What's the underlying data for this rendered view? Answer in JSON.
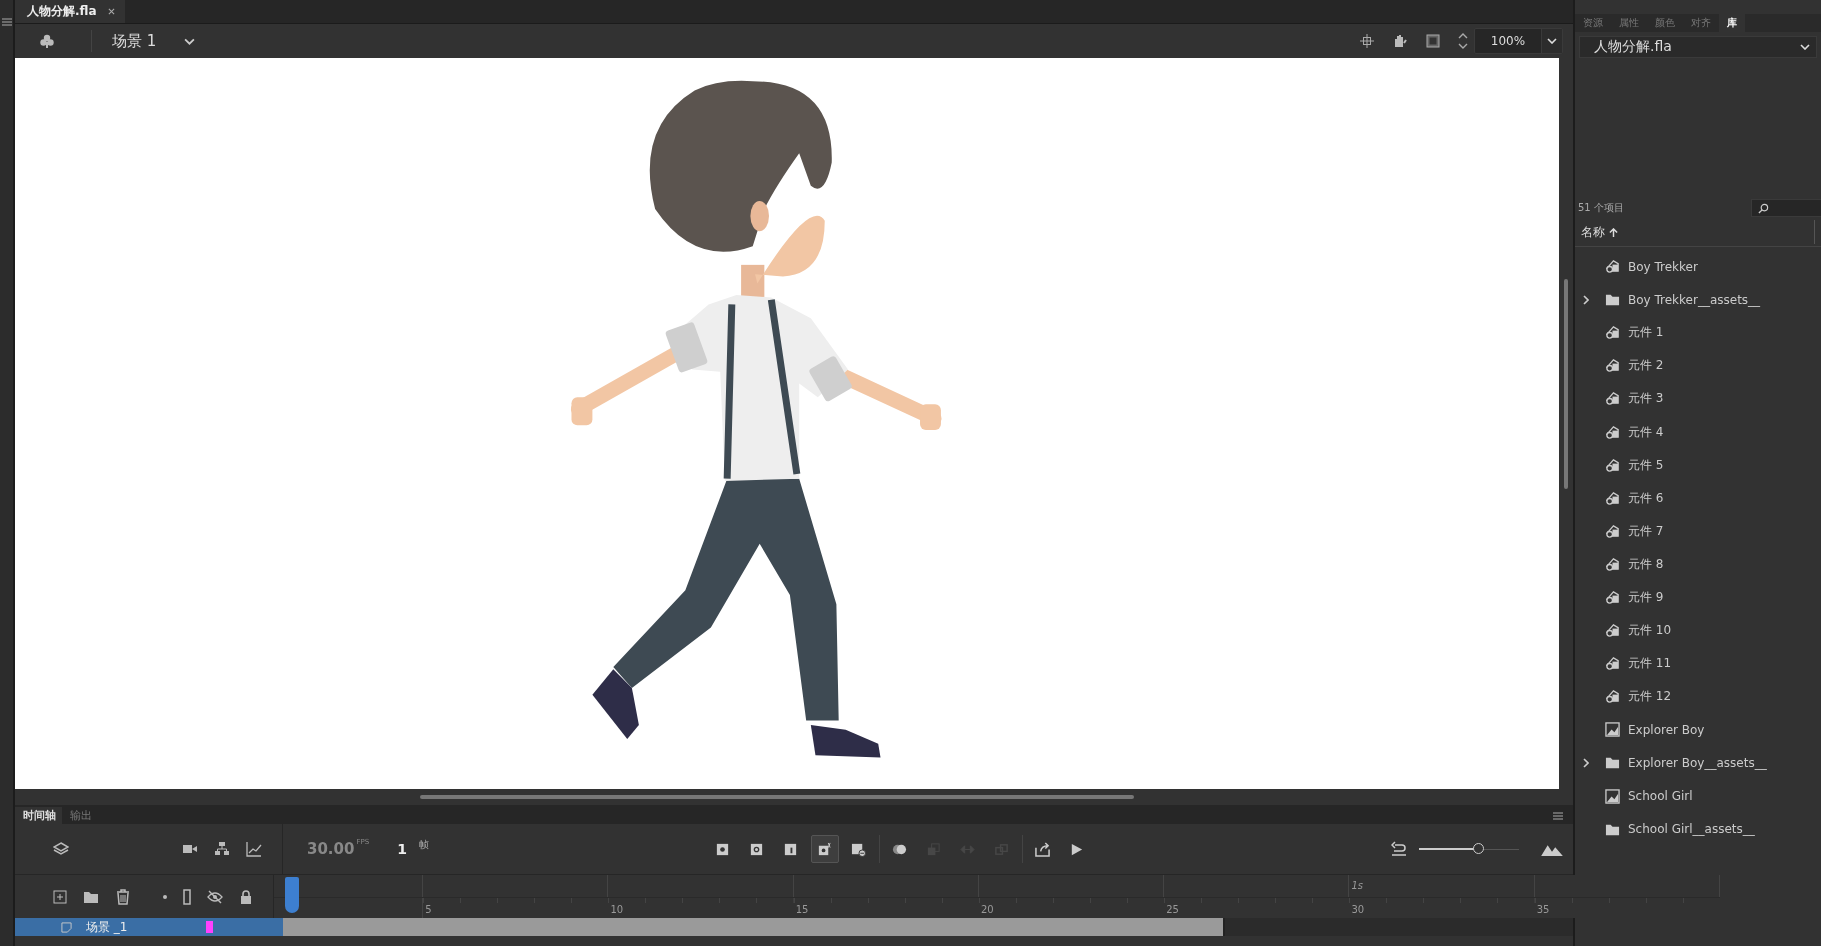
{
  "document_tab": {
    "title": "人物分解.fla",
    "selected": true
  },
  "scene_bar": {
    "scene": "场景 1",
    "zoom": "100%"
  },
  "timeline": {
    "tabs": [
      {
        "label": "时间轴",
        "selected": true
      },
      {
        "label": "输出",
        "selected": false
      }
    ],
    "fps": "30.00",
    "fps_unit": "FPS",
    "frame": "1",
    "frame_unit": "帧",
    "controls": [
      {
        "kind": "keyframe",
        "disabled": false,
        "selected": false
      },
      {
        "kind": "blank-keyframe",
        "disabled": false,
        "selected": false
      },
      {
        "kind": "frame",
        "disabled": false,
        "selected": false
      },
      {
        "kind": "auto-keyframe",
        "disabled": false,
        "selected": true
      },
      {
        "kind": "clear-keyframe",
        "disabled": false,
        "selected": false
      },
      {
        "kind": "onion",
        "disabled": false,
        "selected": false
      },
      {
        "kind": "edit-multiple",
        "disabled": true,
        "selected": false
      },
      {
        "kind": "swap",
        "disabled": true,
        "selected": false
      },
      {
        "kind": "link",
        "disabled": true,
        "selected": false
      },
      {
        "kind": "export",
        "disabled": false,
        "selected": false
      },
      {
        "kind": "play",
        "disabled": false,
        "selected": false
      }
    ],
    "zoom_slider": {
      "level": 0.6
    },
    "ruler": [
      {
        "text": "5"
      },
      {
        "text": "10"
      },
      {
        "text": "15"
      },
      {
        "text": "20"
      },
      {
        "text": "25"
      },
      {
        "text": "30",
        "time": "1s"
      },
      {
        "text": "35"
      }
    ],
    "layers": [
      {
        "name": "场景 _1",
        "selected": true,
        "color": "#ff40ff",
        "level": 0.73
      }
    ]
  },
  "library": {
    "tabs": [
      {
        "label": "资源",
        "selected": false
      },
      {
        "label": "属性",
        "selected": false
      },
      {
        "label": "颜色",
        "selected": false
      },
      {
        "label": "对齐",
        "selected": false
      },
      {
        "label": "库",
        "selected": true
      }
    ],
    "document": "人物分解.fla",
    "count": "51 个项目",
    "column": "名称",
    "items": [
      {
        "name": "Boy Trekker",
        "kind": "symbol",
        "expandable": false
      },
      {
        "name": "Boy Trekker__assets__",
        "kind": "folder",
        "expandable": true
      },
      {
        "name": "元件 1",
        "kind": "symbol",
        "expandable": false
      },
      {
        "name": "元件 2",
        "kind": "symbol",
        "expandable": false
      },
      {
        "name": "元件 3",
        "kind": "symbol",
        "expandable": false
      },
      {
        "name": "元件 4",
        "kind": "symbol",
        "expandable": false
      },
      {
        "name": "元件 5",
        "kind": "symbol",
        "expandable": false
      },
      {
        "name": "元件 6",
        "kind": "symbol",
        "expandable": false
      },
      {
        "name": "元件 7",
        "kind": "symbol",
        "expandable": false
      },
      {
        "name": "元件 8",
        "kind": "symbol",
        "expandable": false
      },
      {
        "name": "元件 9",
        "kind": "symbol",
        "expandable": false
      },
      {
        "name": "元件 10",
        "kind": "symbol",
        "expandable": false
      },
      {
        "name": "元件 11",
        "kind": "symbol",
        "expandable": false
      },
      {
        "name": "元件 12",
        "kind": "symbol",
        "expandable": false
      },
      {
        "name": "Explorer Boy",
        "kind": "clip",
        "expandable": false
      },
      {
        "name": "Explorer Boy__assets__",
        "kind": "folder",
        "expandable": true
      },
      {
        "name": "School Girl",
        "kind": "clip",
        "expandable": false
      },
      {
        "name": "School Girl__assets__",
        "kind": "folder",
        "expandable": false
      }
    ]
  }
}
